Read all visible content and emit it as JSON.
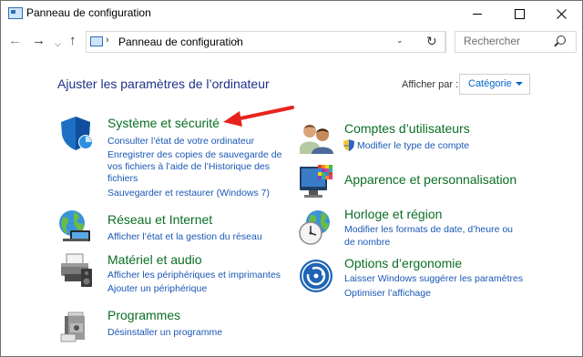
{
  "window": {
    "title": "Panneau de configuration"
  },
  "nav": {
    "address": "Panneau de configuration",
    "search_placeholder": "Rechercher"
  },
  "main": {
    "heading": "Ajuster les paramètres de l’ordinateur",
    "view_by_label": "Afficher par :",
    "view_by_value": "Catégorie"
  },
  "categories": {
    "system": {
      "title": "Système et sécurité",
      "links": [
        "Consulter l’état de votre ordinateur",
        "Enregistrer des copies de sauvegarde de",
        "vos fichiers à l’aide de l’Historique des",
        "fichiers",
        "Sauvegarder et restaurer (Windows 7)"
      ]
    },
    "network": {
      "title": "Réseau et Internet",
      "links": [
        "Afficher l’état et la gestion du réseau"
      ]
    },
    "hardware": {
      "title": "Matériel et audio",
      "links": [
        "Afficher les périphériques et imprimantes",
        "Ajouter un périphérique"
      ]
    },
    "programs": {
      "title": "Programmes",
      "links": [
        "Désinstaller un programme"
      ]
    },
    "users": {
      "title": "Comptes d’utilisateurs",
      "links": [
        "Modifier le type de compte"
      ]
    },
    "appearance": {
      "title": "Apparence et personnalisation",
      "links": []
    },
    "clock": {
      "title": "Horloge et région",
      "links": [
        "Modifier les formats de date, d’heure ou",
        "de nombre"
      ]
    },
    "ease": {
      "title": "Options d’ergonomie",
      "links": [
        "Laisser Windows suggérer les paramètres",
        "Optimiser l’affichage"
      ]
    }
  },
  "colors": {
    "heading": "#1e3287",
    "category_title": "#0a6e24",
    "link": "#1a58b5",
    "annotation_arrow": "#e8231d"
  }
}
